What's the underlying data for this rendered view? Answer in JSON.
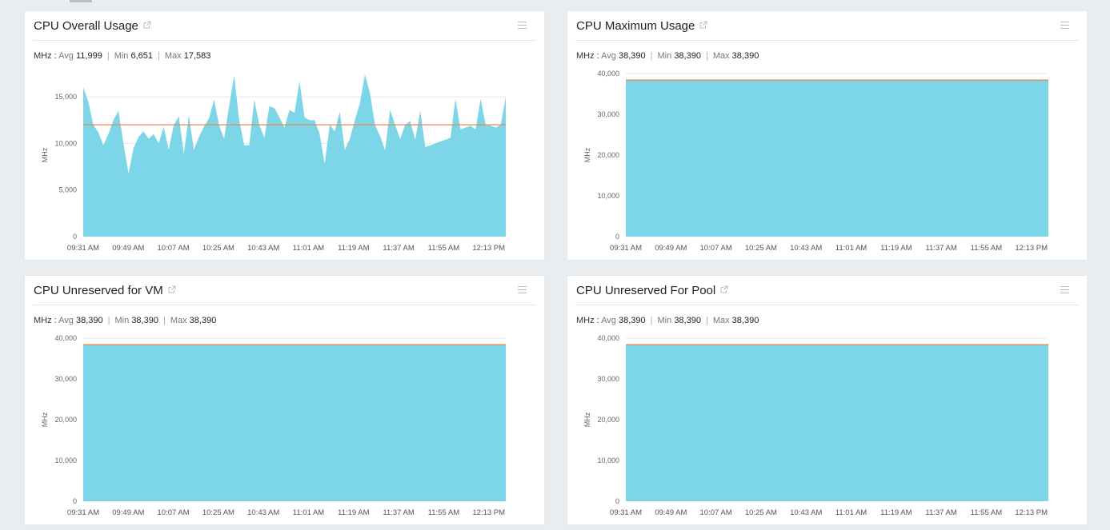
{
  "panels": [
    {
      "title": "CPU Overall Usage",
      "stats": {
        "unit": "MHz",
        "avg_label": "Avg",
        "avg": "11,999",
        "min_label": "Min",
        "min": "6,651",
        "max_label": "Max",
        "max": "17,583"
      }
    },
    {
      "title": "CPU Maximum Usage",
      "stats": {
        "unit": "MHz",
        "avg_label": "Avg",
        "avg": "38,390",
        "min_label": "Min",
        "min": "38,390",
        "max_label": "Max",
        "max": "38,390"
      }
    },
    {
      "title": "CPU Unreserved for VM",
      "stats": {
        "unit": "MHz",
        "avg_label": "Avg",
        "avg": "38,390",
        "min_label": "Min",
        "min": "38,390",
        "max_label": "Max",
        "max": "38,390"
      }
    },
    {
      "title": "CPU Unreserved For Pool",
      "stats": {
        "unit": "MHz",
        "avg_label": "Avg",
        "avg": "38,390",
        "min_label": "Min",
        "min": "38,390",
        "max_label": "Max",
        "max": "38,390"
      }
    }
  ],
  "colors": {
    "area_fill": "#7dd6e8",
    "average_line": "#e8884a",
    "gridline": "#e8e8e8",
    "background": "#e9edf0"
  },
  "chart_data": [
    {
      "type": "area",
      "ylabel": "MHz",
      "ylim": [
        0,
        17500
      ],
      "yticks": [
        0,
        5000,
        10000,
        15000
      ],
      "ytick_labels": [
        "0",
        "5,000",
        "10,000",
        "15,000"
      ],
      "xticks": [
        "09:31 AM",
        "09:49 AM",
        "10:07 AM",
        "10:25 AM",
        "10:43 AM",
        "11:01 AM",
        "11:19 AM",
        "11:37 AM",
        "11:55 AM",
        "12:13 PM"
      ],
      "x_count": 85,
      "average": 11999,
      "values": [
        16000,
        14500,
        12000,
        11200,
        9800,
        11000,
        12500,
        13500,
        10000,
        6800,
        9500,
        10700,
        11300,
        10500,
        11000,
        10000,
        11800,
        9300,
        12000,
        12900,
        8900,
        13000,
        9300,
        10700,
        11800,
        12700,
        14700,
        12000,
        10500,
        14000,
        17300,
        12500,
        9800,
        9800,
        14700,
        12000,
        10600,
        14000,
        13800,
        12800,
        11700,
        13600,
        13300,
        16700,
        12800,
        12500,
        12500,
        11000,
        7800,
        12000,
        11300,
        13400,
        9300,
        10500,
        12500,
        14300,
        17400,
        15400,
        12000,
        10800,
        9300,
        13600,
        12000,
        10500,
        12000,
        12400,
        10400,
        13500,
        9600,
        9800,
        10000,
        10200,
        10400,
        10600,
        14800,
        11500,
        11700,
        11900,
        11500,
        14800,
        12000,
        11900,
        11700,
        12000,
        15000
      ]
    },
    {
      "type": "area",
      "ylabel": "MHz",
      "ylim": [
        0,
        40000
      ],
      "yticks": [
        0,
        10000,
        20000,
        30000,
        40000
      ],
      "ytick_labels": [
        "0",
        "10,000",
        "20,000",
        "30,000",
        "40,000"
      ],
      "xticks": [
        "09:31 AM",
        "09:49 AM",
        "10:07 AM",
        "10:25 AM",
        "10:43 AM",
        "11:01 AM",
        "11:19 AM",
        "11:37 AM",
        "11:55 AM",
        "12:13 PM"
      ],
      "x_count": 85,
      "average": 38390,
      "constant": 38390
    },
    {
      "type": "area",
      "ylabel": "MHz",
      "ylim": [
        0,
        40000
      ],
      "yticks": [
        0,
        10000,
        20000,
        30000,
        40000
      ],
      "ytick_labels": [
        "0",
        "10,000",
        "20,000",
        "30,000",
        "40,000"
      ],
      "xticks": [
        "09:31 AM",
        "09:49 AM",
        "10:07 AM",
        "10:25 AM",
        "10:43 AM",
        "11:01 AM",
        "11:19 AM",
        "11:37 AM",
        "11:55 AM",
        "12:13 PM"
      ],
      "x_count": 85,
      "average": 38390,
      "constant": 38390
    },
    {
      "type": "area",
      "ylabel": "MHz",
      "ylim": [
        0,
        40000
      ],
      "yticks": [
        0,
        10000,
        20000,
        30000,
        40000
      ],
      "ytick_labels": [
        "0",
        "10,000",
        "20,000",
        "30,000",
        "40,000"
      ],
      "xticks": [
        "09:31 AM",
        "09:49 AM",
        "10:07 AM",
        "10:25 AM",
        "10:43 AM",
        "11:01 AM",
        "11:19 AM",
        "11:37 AM",
        "11:55 AM",
        "12:13 PM"
      ],
      "x_count": 85,
      "average": 38390,
      "constant": 38390
    }
  ]
}
